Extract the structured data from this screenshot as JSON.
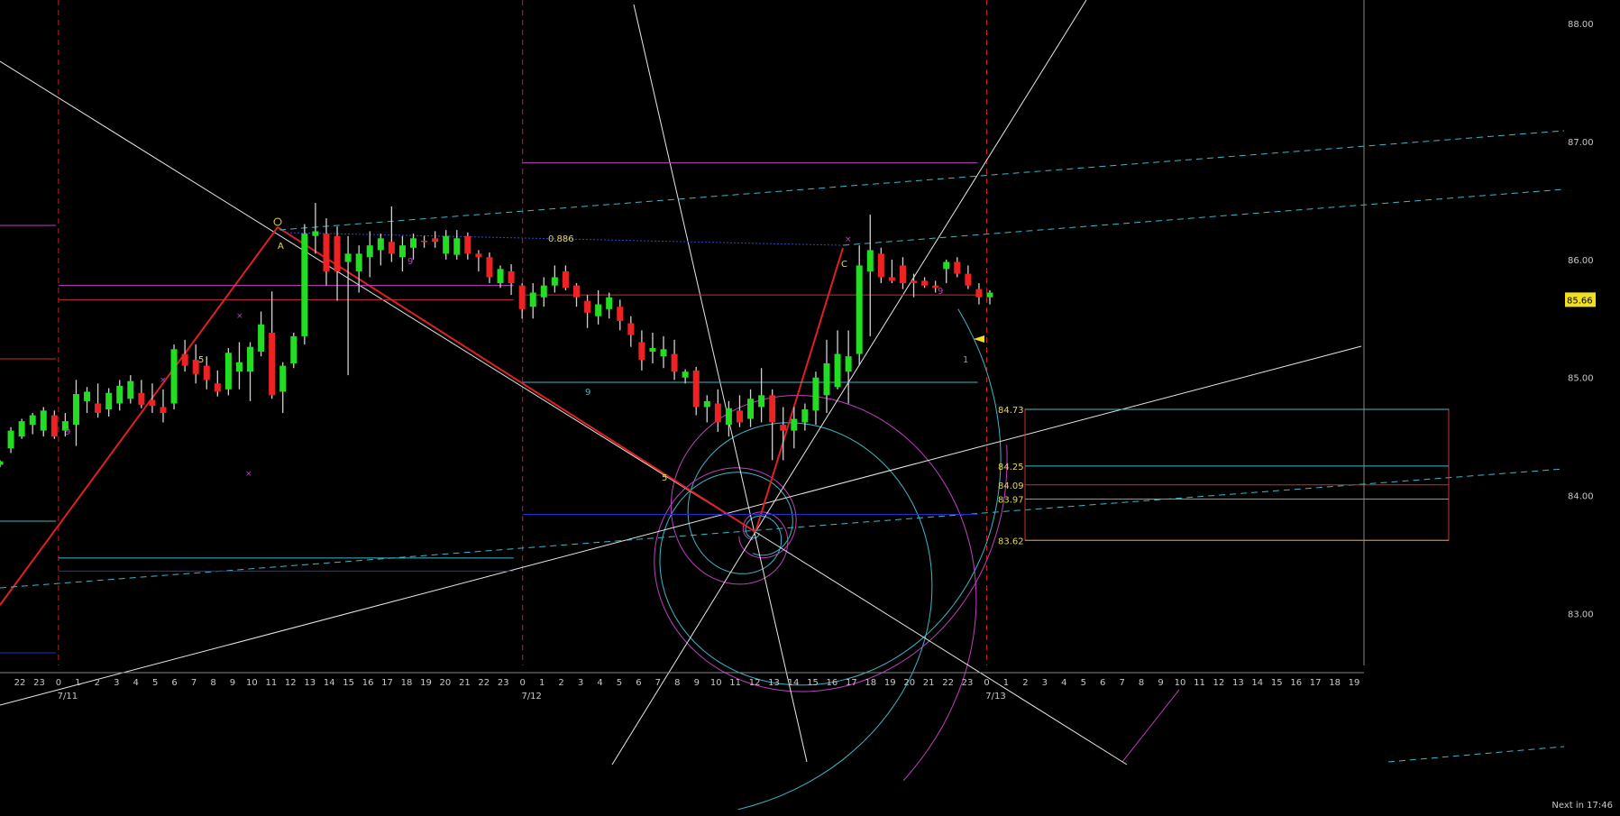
{
  "chart_data": {
    "type": "candlestick",
    "title": "",
    "ylim": [
      82.56,
      88.2
    ],
    "y_ticks": [
      "88.00",
      "87.00",
      "86.00",
      "85.00",
      "84.00",
      "83.00"
    ],
    "last_price": "85.66",
    "x_hour_labels": [
      "22",
      "23",
      "0",
      "1",
      "2",
      "3",
      "4",
      "5",
      "6",
      "7",
      "8",
      "9",
      "10",
      "11",
      "12",
      "13",
      "14",
      "15",
      "16",
      "17",
      "18",
      "19",
      "20",
      "21",
      "22",
      "23",
      "0",
      "1",
      "2",
      "3",
      "4",
      "5",
      "6",
      "7",
      "8",
      "9",
      "10",
      "11",
      "12",
      "13",
      "14",
      "15",
      "16",
      "17",
      "18",
      "19",
      "20",
      "21",
      "22",
      "23",
      "0",
      "1",
      "2",
      "3",
      "4",
      "5",
      "6",
      "7",
      "8",
      "9",
      "10",
      "11",
      "12",
      "13",
      "14",
      "15",
      "16",
      "17",
      "18",
      "19"
    ],
    "date_labels": [
      {
        "label": "7/11",
        "hour_index": 2
      },
      {
        "label": "7/12",
        "hour_index": 26
      },
      {
        "label": "7/13",
        "hour_index": 50
      }
    ],
    "candles": [
      {
        "o": 84.26,
        "h": 84.3,
        "l": 84.24,
        "c": 84.29
      },
      {
        "o": 84.4,
        "h": 84.58,
        "l": 84.36,
        "c": 84.55
      },
      {
        "o": 84.5,
        "h": 84.65,
        "l": 84.48,
        "c": 84.63
      },
      {
        "o": 84.6,
        "h": 84.7,
        "l": 84.52,
        "c": 84.68
      },
      {
        "o": 84.55,
        "h": 84.75,
        "l": 84.5,
        "c": 84.72
      },
      {
        "o": 84.68,
        "h": 84.72,
        "l": 84.48,
        "c": 84.5
      },
      {
        "o": 84.55,
        "h": 84.7,
        "l": 84.5,
        "c": 84.63
      },
      {
        "o": 84.6,
        "h": 84.98,
        "l": 84.42,
        "c": 84.86
      },
      {
        "o": 84.8,
        "h": 84.92,
        "l": 84.7,
        "c": 84.88
      },
      {
        "o": 84.78,
        "h": 84.95,
        "l": 84.66,
        "c": 84.7
      },
      {
        "o": 84.73,
        "h": 84.91,
        "l": 84.67,
        "c": 84.87
      },
      {
        "o": 84.78,
        "h": 84.98,
        "l": 84.72,
        "c": 84.93
      },
      {
        "o": 84.82,
        "h": 85.02,
        "l": 84.78,
        "c": 84.97
      },
      {
        "o": 84.87,
        "h": 84.98,
        "l": 84.74,
        "c": 84.77
      },
      {
        "o": 84.81,
        "h": 84.95,
        "l": 84.7,
        "c": 84.76
      },
      {
        "o": 84.75,
        "h": 84.9,
        "l": 84.62,
        "c": 84.7
      },
      {
        "o": 84.78,
        "h": 85.28,
        "l": 84.73,
        "c": 85.24
      },
      {
        "o": 85.2,
        "h": 85.32,
        "l": 85.05,
        "c": 85.1
      },
      {
        "o": 85.15,
        "h": 85.28,
        "l": 84.95,
        "c": 85.03
      },
      {
        "o": 85.1,
        "h": 85.18,
        "l": 84.9,
        "c": 84.98
      },
      {
        "o": 84.95,
        "h": 85.06,
        "l": 84.84,
        "c": 84.88
      },
      {
        "o": 84.9,
        "h": 85.25,
        "l": 84.85,
        "c": 85.21
      },
      {
        "o": 85.05,
        "h": 85.3,
        "l": 84.9,
        "c": 85.13
      },
      {
        "o": 85.05,
        "h": 85.3,
        "l": 84.8,
        "c": 85.26
      },
      {
        "o": 85.22,
        "h": 85.56,
        "l": 85.18,
        "c": 85.45
      },
      {
        "o": 85.38,
        "h": 85.73,
        "l": 84.82,
        "c": 84.85
      },
      {
        "o": 84.88,
        "h": 85.13,
        "l": 84.7,
        "c": 85.1
      },
      {
        "o": 85.12,
        "h": 85.38,
        "l": 85.08,
        "c": 85.35
      },
      {
        "o": 85.35,
        "h": 86.3,
        "l": 85.28,
        "c": 86.22
      },
      {
        "o": 86.2,
        "h": 86.48,
        "l": 86.05,
        "c": 86.24
      },
      {
        "o": 86.22,
        "h": 86.35,
        "l": 85.78,
        "c": 85.9
      },
      {
        "o": 86.2,
        "h": 86.28,
        "l": 85.65,
        "c": 85.9
      },
      {
        "o": 85.98,
        "h": 86.2,
        "l": 85.02,
        "c": 86.05
      },
      {
        "o": 85.9,
        "h": 86.12,
        "l": 85.72,
        "c": 86.05
      },
      {
        "o": 86.02,
        "h": 86.24,
        "l": 85.85,
        "c": 86.12
      },
      {
        "o": 86.08,
        "h": 86.22,
        "l": 85.95,
        "c": 86.18
      },
      {
        "o": 86.15,
        "h": 86.45,
        "l": 85.98,
        "c": 86.05
      },
      {
        "o": 86.02,
        "h": 86.2,
        "l": 85.9,
        "c": 86.12
      },
      {
        "o": 86.1,
        "h": 86.22,
        "l": 86.0,
        "c": 86.18
      },
      {
        "o": 86.16,
        "h": 86.2,
        "l": 86.1,
        "c": 86.15
      },
      {
        "o": 86.18,
        "h": 86.24,
        "l": 86.1,
        "c": 86.15
      },
      {
        "o": 86.05,
        "h": 86.25,
        "l": 86.0,
        "c": 86.2
      },
      {
        "o": 86.04,
        "h": 86.25,
        "l": 86.0,
        "c": 86.18
      },
      {
        "o": 86.2,
        "h": 86.23,
        "l": 86.0,
        "c": 86.05
      },
      {
        "o": 86.05,
        "h": 86.08,
        "l": 85.9,
        "c": 86.02
      },
      {
        "o": 86.02,
        "h": 86.06,
        "l": 85.8,
        "c": 85.85
      },
      {
        "o": 85.8,
        "h": 85.95,
        "l": 85.76,
        "c": 85.92
      },
      {
        "o": 85.9,
        "h": 85.96,
        "l": 85.7,
        "c": 85.8
      },
      {
        "o": 85.78,
        "h": 85.8,
        "l": 85.5,
        "c": 85.58
      },
      {
        "o": 85.6,
        "h": 85.8,
        "l": 85.5,
        "c": 85.72
      },
      {
        "o": 85.68,
        "h": 85.85,
        "l": 85.6,
        "c": 85.78
      },
      {
        "o": 85.78,
        "h": 85.95,
        "l": 85.72,
        "c": 85.85
      },
      {
        "o": 85.9,
        "h": 85.95,
        "l": 85.74,
        "c": 85.76
      },
      {
        "o": 85.78,
        "h": 85.8,
        "l": 85.6,
        "c": 85.68
      },
      {
        "o": 85.65,
        "h": 85.7,
        "l": 85.42,
        "c": 85.55
      },
      {
        "o": 85.52,
        "h": 85.74,
        "l": 85.45,
        "c": 85.62
      },
      {
        "o": 85.58,
        "h": 85.72,
        "l": 85.5,
        "c": 85.68
      },
      {
        "o": 85.6,
        "h": 85.66,
        "l": 85.4,
        "c": 85.48
      },
      {
        "o": 85.46,
        "h": 85.52,
        "l": 85.26,
        "c": 85.36
      },
      {
        "o": 85.3,
        "h": 85.4,
        "l": 85.06,
        "c": 85.15
      },
      {
        "o": 85.22,
        "h": 85.38,
        "l": 85.12,
        "c": 85.25
      },
      {
        "o": 85.18,
        "h": 85.35,
        "l": 85.08,
        "c": 85.24
      },
      {
        "o": 85.2,
        "h": 85.32,
        "l": 84.98,
        "c": 85.05
      },
      {
        "o": 85.0,
        "h": 85.07,
        "l": 84.95,
        "c": 85.05
      },
      {
        "o": 85.06,
        "h": 85.09,
        "l": 84.68,
        "c": 84.75
      },
      {
        "o": 84.75,
        "h": 84.85,
        "l": 84.62,
        "c": 84.8
      },
      {
        "o": 84.78,
        "h": 84.9,
        "l": 84.54,
        "c": 84.62
      },
      {
        "o": 84.6,
        "h": 84.8,
        "l": 84.5,
        "c": 84.74
      },
      {
        "o": 84.72,
        "h": 84.85,
        "l": 84.58,
        "c": 84.62
      },
      {
        "o": 84.65,
        "h": 84.9,
        "l": 84.58,
        "c": 84.82
      },
      {
        "o": 84.75,
        "h": 85.08,
        "l": 84.62,
        "c": 84.85
      },
      {
        "o": 84.85,
        "h": 84.9,
        "l": 84.3,
        "c": 84.62
      },
      {
        "o": 84.6,
        "h": 84.75,
        "l": 84.3,
        "c": 84.55
      },
      {
        "o": 84.55,
        "h": 84.75,
        "l": 84.4,
        "c": 84.65
      },
      {
        "o": 84.62,
        "h": 84.78,
        "l": 84.55,
        "c": 84.73
      },
      {
        "o": 84.72,
        "h": 85.05,
        "l": 84.6,
        "c": 85.0
      },
      {
        "o": 84.85,
        "h": 85.32,
        "l": 84.7,
        "c": 85.12
      },
      {
        "o": 84.92,
        "h": 85.4,
        "l": 84.9,
        "c": 85.2
      },
      {
        "o": 85.05,
        "h": 85.4,
        "l": 84.78,
        "c": 85.18
      },
      {
        "o": 85.2,
        "h": 86.12,
        "l": 85.1,
        "c": 85.95
      },
      {
        "o": 85.9,
        "h": 86.38,
        "l": 85.35,
        "c": 86.08
      },
      {
        "o": 86.05,
        "h": 86.1,
        "l": 85.8,
        "c": 85.85
      },
      {
        "o": 85.85,
        "h": 86.0,
        "l": 85.8,
        "c": 85.82
      },
      {
        "o": 85.95,
        "h": 86.02,
        "l": 85.75,
        "c": 85.8
      },
      {
        "o": 85.82,
        "h": 85.88,
        "l": 85.68,
        "c": 85.8
      },
      {
        "o": 85.82,
        "h": 85.85,
        "l": 85.76,
        "c": 85.78
      },
      {
        "o": 85.78,
        "h": 85.82,
        "l": 85.72,
        "c": 85.76
      },
      {
        "o": 85.92,
        "h": 86.0,
        "l": 85.8,
        "c": 85.98
      },
      {
        "o": 85.98,
        "h": 86.02,
        "l": 85.85,
        "c": 85.88
      },
      {
        "o": 85.88,
        "h": 85.95,
        "l": 85.75,
        "c": 85.78
      },
      {
        "o": 85.75,
        "h": 85.8,
        "l": 85.62,
        "c": 85.68
      },
      {
        "o": 85.68,
        "h": 85.74,
        "l": 85.62,
        "c": 85.72
      }
    ],
    "horizontal_levels": [
      {
        "value": 86.82,
        "color": "#c040c0",
        "span": "7/12-7/13"
      },
      {
        "value": 85.78,
        "color": "#c040c0",
        "span": "7/11-7/12"
      },
      {
        "value": 85.66,
        "color": "#c83030",
        "span": "7/11-7/12"
      },
      {
        "value": 85.7,
        "color": "#c83030",
        "span": "7/12-7/13"
      },
      {
        "value": 84.96,
        "color": "#3cb8c8",
        "span": "7/12-7/13"
      },
      {
        "value": 83.84,
        "color": "#2030c8",
        "span": "7/12-7/13"
      },
      {
        "value": 83.47,
        "color": "#3cb8c8",
        "span": "7/11-7/12"
      },
      {
        "value": 83.36,
        "color": "#2030c8",
        "span": "7/11-7/12"
      }
    ],
    "fib_annotation": "0.886",
    "target_levels": [
      {
        "label": "84.73",
        "value": 84.73,
        "color": "#3cb8c8"
      },
      {
        "label": "84.25",
        "value": 84.25,
        "color": "#3cb8c8"
      },
      {
        "label": "84.09",
        "value": 84.09,
        "color": "#c83030"
      },
      {
        "label": "83.97",
        "value": 83.97,
        "color": "#3cb8c8"
      },
      {
        "label": "83.62",
        "value": 83.62,
        "color": "#c8a030"
      }
    ],
    "pattern_labels": [
      "A",
      "C"
    ],
    "count_labels": [
      {
        "text": "9",
        "color": "#c040c0"
      },
      {
        "text": "5",
        "color": "#e8d84a"
      },
      {
        "text": "9",
        "color": "#c040c0"
      },
      {
        "text": "9",
        "color": "#3cb8c8"
      },
      {
        "text": "5",
        "color": "#e8d84a"
      },
      {
        "text": "9",
        "color": "#c040c0"
      },
      {
        "text": "1",
        "color": "#3cb8c8"
      }
    ],
    "colors": {
      "up": "#22dd22",
      "down": "#ee2222",
      "wick": "#d0d0d0",
      "grid_vline": "#c82020",
      "axis": "#c8c8c8",
      "price_tag": "#f0e020",
      "cyan": "#3cb8c8",
      "magenta": "#c040c0",
      "white": "#e8e8e8"
    }
  },
  "status_bar": {
    "next_bar": "Next in 17:46"
  }
}
